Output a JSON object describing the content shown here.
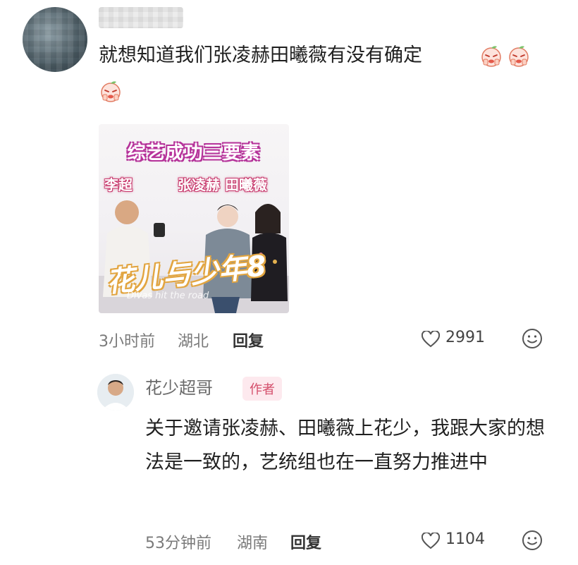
{
  "comment": {
    "username": "",
    "text": "就想知道我们张凌赫田曦薇有没有确定",
    "emoji_icons": [
      "peach-face-icon",
      "peach-face-icon",
      "peach-face-icon"
    ],
    "image": {
      "title": "综艺成功三要素",
      "name_left": "李超",
      "name_right": "张凌赫 田曦薇",
      "logo": "花儿与少年8",
      "subtitle": "Divas hit the road"
    },
    "time": "3小时前",
    "location": "湖北",
    "reply_label": "回复",
    "like_count": "2991"
  },
  "author_reply": {
    "username": "花少超哥",
    "badge": "作者",
    "text": "关于邀请张凌赫、田曦薇上花少，我跟大家的想法是一致的，艺统组也在一直努力推进中",
    "time": "53分钟前",
    "location": "湖南",
    "reply_label": "回复",
    "like_count": "1104"
  },
  "colors": {
    "badge_text": "#d44e6b",
    "badge_bg": "#fde9ee",
    "meta": "#7a7a7a"
  }
}
